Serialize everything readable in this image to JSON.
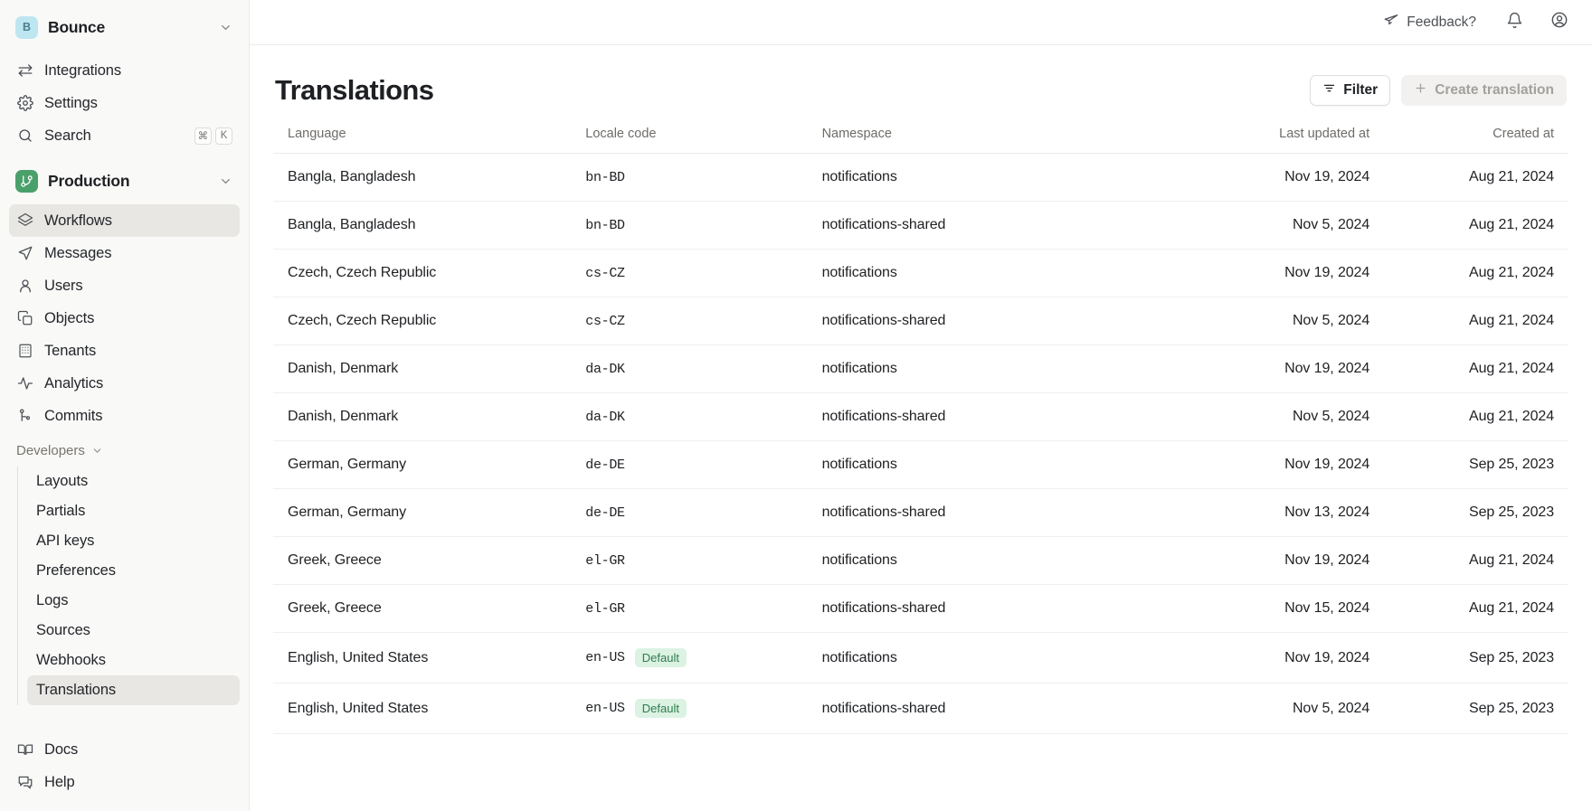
{
  "sidebar": {
    "org": {
      "initial": "B",
      "name": "Bounce",
      "chevron_icon": "chevron-down-icon"
    },
    "top_items": [
      {
        "label": "Integrations",
        "icon": "arrows-exchange-icon"
      },
      {
        "label": "Settings",
        "icon": "gear-icon"
      },
      {
        "label": "Search",
        "icon": "search-icon",
        "kbd": [
          "⌘",
          "K"
        ]
      }
    ],
    "environment": {
      "name": "Production",
      "icon": "branch-icon",
      "chevron_icon": "chevron-down-icon"
    },
    "env_items": [
      {
        "label": "Workflows",
        "icon": "layers-icon",
        "active": true
      },
      {
        "label": "Messages",
        "icon": "send-icon",
        "active": false
      },
      {
        "label": "Users",
        "icon": "user-icon",
        "active": false
      },
      {
        "label": "Objects",
        "icon": "copy-icon",
        "active": false
      },
      {
        "label": "Tenants",
        "icon": "building-icon",
        "active": false
      },
      {
        "label": "Analytics",
        "icon": "activity-icon",
        "active": false
      },
      {
        "label": "Commits",
        "icon": "commit-branch-icon",
        "active": false
      }
    ],
    "developers": {
      "label": "Developers",
      "chevron_icon": "chevron-down-icon"
    },
    "developer_items": [
      {
        "label": "Layouts",
        "active": false
      },
      {
        "label": "Partials",
        "active": false
      },
      {
        "label": "API keys",
        "active": false
      },
      {
        "label": "Preferences",
        "active": false
      },
      {
        "label": "Logs",
        "active": false
      },
      {
        "label": "Sources",
        "active": false
      },
      {
        "label": "Webhooks",
        "active": false
      },
      {
        "label": "Translations",
        "active": true
      }
    ],
    "bottom_items": [
      {
        "label": "Docs",
        "icon": "book-icon"
      },
      {
        "label": "Help",
        "icon": "chat-help-icon"
      }
    ]
  },
  "topbar": {
    "feedback_label": "Feedback?",
    "feedback_icon": "megaphone-icon",
    "notifications_icon": "bell-icon",
    "account_icon": "user-circle-icon"
  },
  "page": {
    "title": "Translations",
    "filter_label": "Filter",
    "filter_icon": "filter-icon",
    "create_label": "Create translation",
    "create_icon": "plus-icon"
  },
  "table": {
    "columns": [
      {
        "key": "language",
        "label": "Language",
        "align": "left"
      },
      {
        "key": "locale",
        "label": "Locale code",
        "align": "left"
      },
      {
        "key": "namespace",
        "label": "Namespace",
        "align": "left"
      },
      {
        "key": "updated",
        "label": "Last updated at",
        "align": "right"
      },
      {
        "key": "created",
        "label": "Created at",
        "align": "right"
      }
    ],
    "rows": [
      {
        "language": "Bangla, Bangladesh",
        "locale": "bn-BD",
        "badge": "",
        "namespace": "notifications",
        "updated": "Nov 19, 2024",
        "created": "Aug 21, 2024"
      },
      {
        "language": "Bangla, Bangladesh",
        "locale": "bn-BD",
        "badge": "",
        "namespace": "notifications-shared",
        "updated": "Nov 5, 2024",
        "created": "Aug 21, 2024"
      },
      {
        "language": "Czech, Czech Republic",
        "locale": "cs-CZ",
        "badge": "",
        "namespace": "notifications",
        "updated": "Nov 19, 2024",
        "created": "Aug 21, 2024"
      },
      {
        "language": "Czech, Czech Republic",
        "locale": "cs-CZ",
        "badge": "",
        "namespace": "notifications-shared",
        "updated": "Nov 5, 2024",
        "created": "Aug 21, 2024"
      },
      {
        "language": "Danish, Denmark",
        "locale": "da-DK",
        "badge": "",
        "namespace": "notifications",
        "updated": "Nov 19, 2024",
        "created": "Aug 21, 2024"
      },
      {
        "language": "Danish, Denmark",
        "locale": "da-DK",
        "badge": "",
        "namespace": "notifications-shared",
        "updated": "Nov 5, 2024",
        "created": "Aug 21, 2024"
      },
      {
        "language": "German, Germany",
        "locale": "de-DE",
        "badge": "",
        "namespace": "notifications",
        "updated": "Nov 19, 2024",
        "created": "Sep 25, 2023"
      },
      {
        "language": "German, Germany",
        "locale": "de-DE",
        "badge": "",
        "namespace": "notifications-shared",
        "updated": "Nov 13, 2024",
        "created": "Sep 25, 2023"
      },
      {
        "language": "Greek, Greece",
        "locale": "el-GR",
        "badge": "",
        "namespace": "notifications",
        "updated": "Nov 19, 2024",
        "created": "Aug 21, 2024"
      },
      {
        "language": "Greek, Greece",
        "locale": "el-GR",
        "badge": "",
        "namespace": "notifications-shared",
        "updated": "Nov 15, 2024",
        "created": "Aug 21, 2024"
      },
      {
        "language": "English, United States",
        "locale": "en-US",
        "badge": "Default",
        "namespace": "notifications",
        "updated": "Nov 19, 2024",
        "created": "Sep 25, 2023"
      },
      {
        "language": "English, United States",
        "locale": "en-US",
        "badge": "Default",
        "namespace": "notifications-shared",
        "updated": "Nov 5, 2024",
        "created": "Sep 25, 2023"
      }
    ]
  },
  "colors": {
    "sidebar_bg": "#f9f9f8",
    "active_item": "#e8e7e4",
    "org_avatar": "#bde6f0",
    "env_avatar": "#4aa06a",
    "badge_bg": "#dcf2e3",
    "badge_fg": "#2f7d4f",
    "text_primary": "#1e2023",
    "text_muted": "#6e6c68"
  }
}
